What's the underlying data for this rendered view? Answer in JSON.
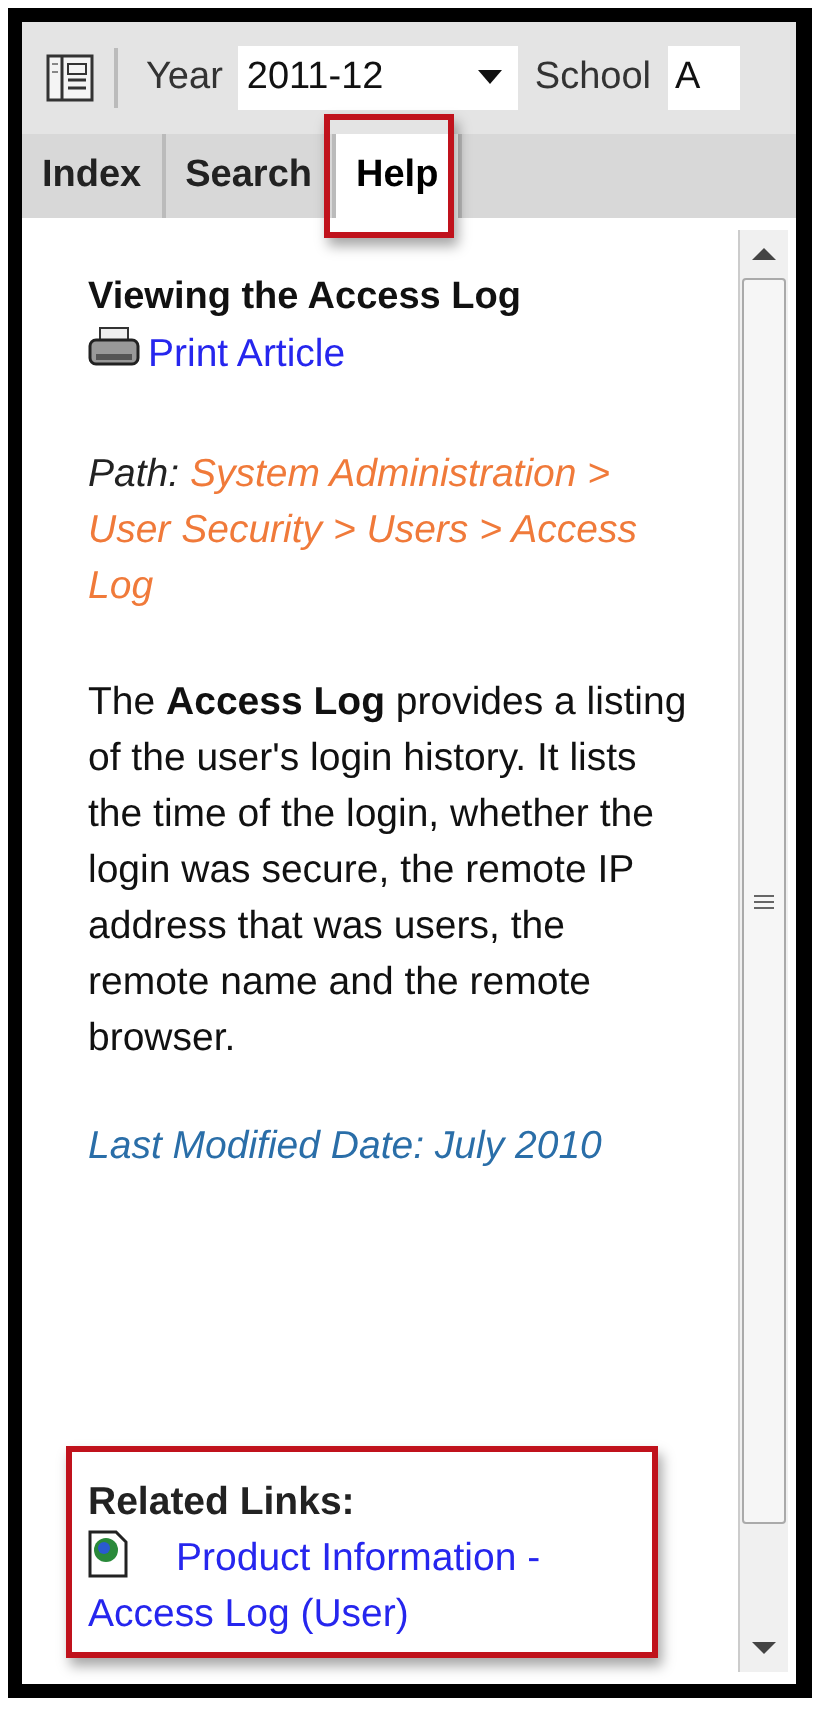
{
  "toolbar": {
    "year_label": "Year",
    "year_value": "2011-12",
    "school_label": "School",
    "school_value": "A"
  },
  "tabs": [
    {
      "label": "Index",
      "selected": false,
      "highlighted": false
    },
    {
      "label": "Search",
      "selected": false,
      "highlighted": false
    },
    {
      "label": "Help",
      "selected": true,
      "highlighted": true
    }
  ],
  "article": {
    "title": "Viewing the Access Log",
    "print_link": "Print Article",
    "path_label": "Path:",
    "path": "System Administration > User Security > Users > Access Log",
    "body": "The **Access Log** provides a listing of the user's login history.  It lists the time of the login, whether the login was secure, the remote IP address that was users, the remote name and the remote browser.",
    "modified": "Last Modified Date: July 2010"
  },
  "related_links": {
    "heading": "Related Links:",
    "highlighted": true,
    "links": [
      "Product Information - Access Log (User)"
    ]
  }
}
